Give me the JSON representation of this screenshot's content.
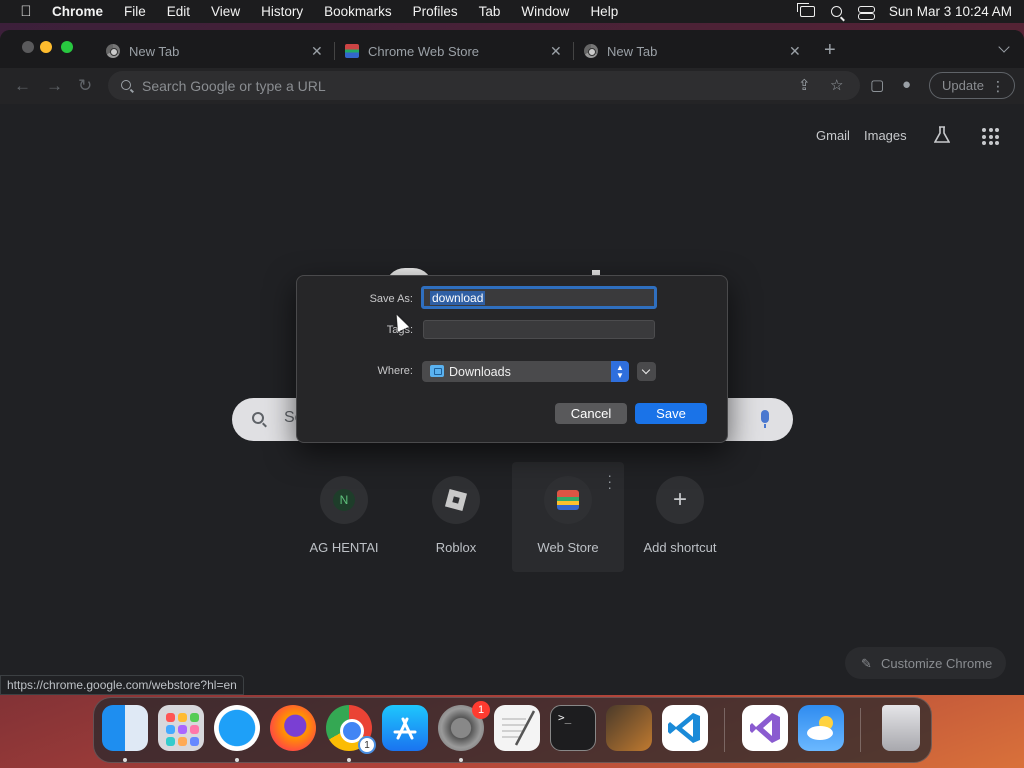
{
  "menubar": {
    "app_name": "Chrome",
    "items": [
      "File",
      "Edit",
      "View",
      "History",
      "Bookmarks",
      "Profiles",
      "Tab",
      "Window",
      "Help"
    ],
    "clock": "Sun Mar 3  10:24 AM"
  },
  "tabs": [
    {
      "title": "New Tab",
      "icon": "chrome-icon"
    },
    {
      "title": "Chrome Web Store",
      "icon": "web-store-icon"
    },
    {
      "title": "New Tab",
      "icon": "chrome-icon"
    }
  ],
  "toolbar": {
    "omnibox_placeholder": "Search Google or type a URL",
    "update_label": "Update"
  },
  "ntp": {
    "links": [
      "Gmail",
      "Images"
    ],
    "search_placeholder": "Se",
    "shortcuts": [
      {
        "label": "AG HENTAI",
        "icon_text": "N"
      },
      {
        "label": "Roblox"
      },
      {
        "label": "Web Store"
      },
      {
        "label": "Add shortcut",
        "icon_text": "+"
      }
    ],
    "customize_label": "Customize Chrome"
  },
  "dialog": {
    "save_as_label": "Save As:",
    "save_as_value": "download",
    "tags_label": "Tags:",
    "where_label": "Where:",
    "where_value": "Downloads",
    "cancel_label": "Cancel",
    "save_label": "Save"
  },
  "status_url": "https://chrome.google.com/webstore?hl=en",
  "dock": {
    "settings_badge": "1",
    "chrome_badge": "1"
  }
}
